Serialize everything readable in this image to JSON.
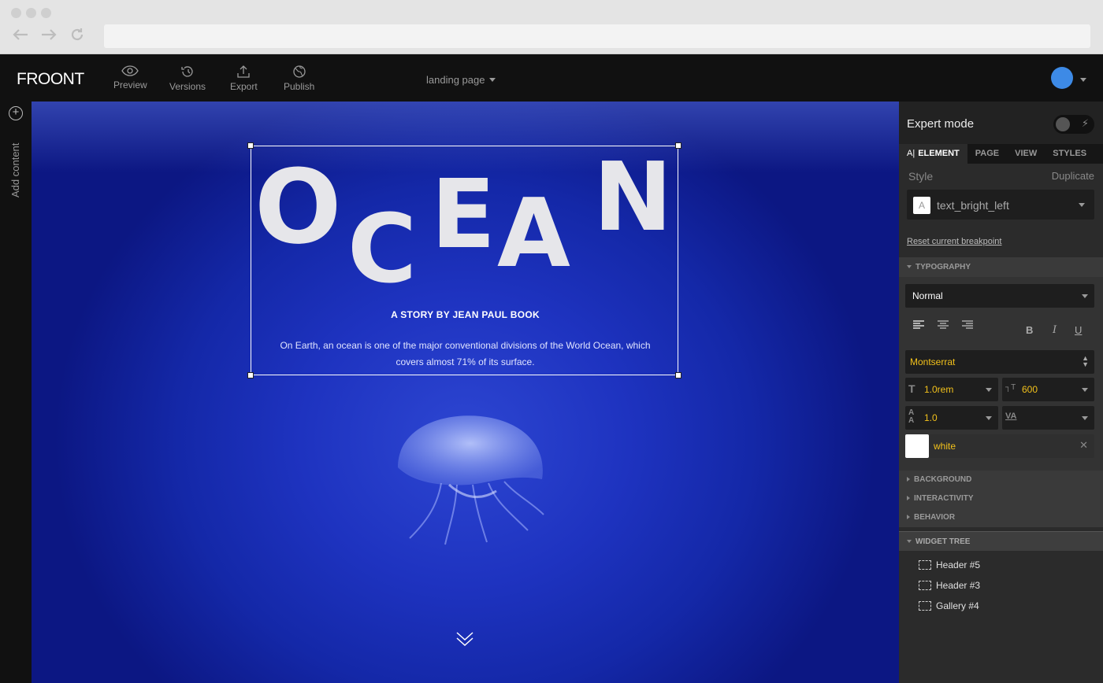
{
  "app": {
    "logo": "FROONT",
    "page_name": "landing page"
  },
  "toolbar": {
    "preview": "Preview",
    "versions": "Versions",
    "export": "Export",
    "publish": "Publish"
  },
  "sidebar": {
    "add_content": "Add content"
  },
  "canvas": {
    "hero_letters": [
      "O",
      "C",
      "E",
      "A",
      "N"
    ],
    "byline": "A STORY BY JEAN PAUL BOOK",
    "description": "On Earth, an ocean is one of the major conventional divisions of the World Ocean, which covers almost 71% of its surface."
  },
  "panel": {
    "expert_mode": "Expert mode",
    "tabs": [
      "ELEMENT",
      "PAGE",
      "VIEW",
      "STYLES"
    ],
    "style_label": "Style",
    "duplicate": "Duplicate",
    "style_value": "text_bright_left",
    "reset": "Reset current breakpoint",
    "typography": {
      "header": "TYPOGRAPHY",
      "weight_style": "Normal",
      "font_family": "Montserrat",
      "font_size": "1.0rem",
      "font_weight": "600",
      "line_height": "1.0",
      "letter_spacing": "",
      "color": "white"
    },
    "sections": [
      "BACKGROUND",
      "INTERACTIVITY",
      "BEHAVIOR"
    ],
    "widget_tree": {
      "header": "WIDGET TREE",
      "items": [
        "Header #5",
        "Header #3",
        "Gallery #4"
      ]
    }
  },
  "colors": {
    "accent_value": "#f2c11b",
    "avatar": "#3d8ae6",
    "canvas": "#1e33c0"
  }
}
